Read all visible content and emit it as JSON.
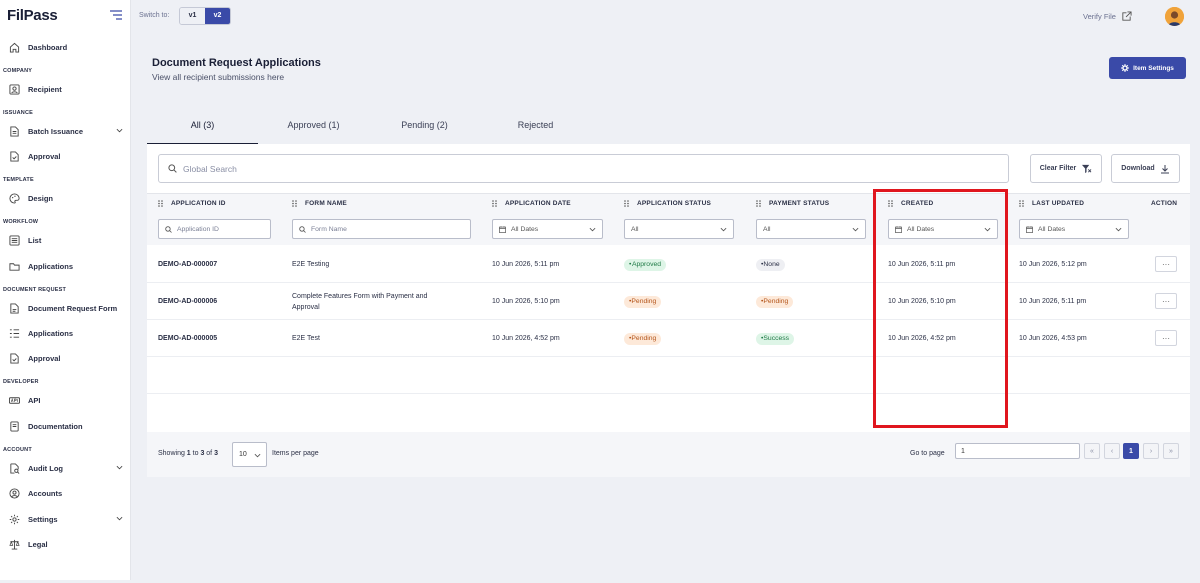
{
  "app": {
    "logo": "FilPass"
  },
  "sidebar": {
    "dashboard": "Dashboard",
    "sections": {
      "company": "COMPANY",
      "issuance": "ISSUANCE",
      "template": "TEMPLATE",
      "workflow": "WORKFLOW",
      "document_request": "DOCUMENT REQUEST",
      "developer": "DEVELOPER",
      "account": "ACCOUNT"
    },
    "items": {
      "recipient": "Recipient",
      "batch_issuance": "Batch Issuance",
      "approval": "Approval",
      "design": "Design",
      "list": "List",
      "applications": "Applications",
      "document_request_form": "Document Request Form",
      "dr_applications": "Applications",
      "dr_approval": "Approval",
      "api": "API",
      "documentation": "Documentation",
      "audit_log": "Audit Log",
      "accounts": "Accounts",
      "settings": "Settings",
      "legal": "Legal"
    }
  },
  "topbar": {
    "switch_label": "Switch to:",
    "v1": "v1",
    "v2": "v2",
    "verify_file": "Verify File"
  },
  "header": {
    "title": "Document Request Applications",
    "subtitle": "View all recipient submissions here",
    "item_settings": "Item Settings"
  },
  "tabs": [
    "All (3)",
    "Approved (1)",
    "Pending (2)",
    "Rejected"
  ],
  "toolbar": {
    "search_placeholder": "Global Search",
    "clear_filter": "Clear Filter",
    "download": "Download"
  },
  "columns": {
    "application_id": "APPLICATION ID",
    "form_name": "FORM NAME",
    "application_date": "APPLICATION DATE",
    "application_status": "APPLICATION STATUS",
    "payment_status": "PAYMENT STATUS",
    "created": "CREATED",
    "last_updated": "LAST UPDATED",
    "action": "ACTION"
  },
  "filters": {
    "application_id_placeholder": "Application ID",
    "form_name_placeholder": "Form Name",
    "all_dates": "All Dates",
    "all": "All"
  },
  "rows": [
    {
      "id": "DEMO-AD-000007",
      "form_name": "E2E Testing",
      "application_date": "10 Jun 2026, 5:11 pm",
      "application_status": "Approved",
      "payment_status": "None",
      "created": "10 Jun 2026, 5:11 pm",
      "last_updated": "10 Jun 2026, 5:12 pm"
    },
    {
      "id": "DEMO-AD-000006",
      "form_name_line1": "Complete Features Form with Payment and",
      "form_name_line2": "Approval",
      "application_date": "10 Jun 2026, 5:10 pm",
      "application_status": "Pending",
      "payment_status": "Pending",
      "created": "10 Jun 2026, 5:10 pm",
      "last_updated": "10 Jun 2026, 5:11 pm"
    },
    {
      "id": "DEMO-AD-000005",
      "form_name": "E2E Test",
      "application_date": "10 Jun 2026, 4:52 pm",
      "application_status": "Pending",
      "payment_status": "Success",
      "created": "10 Jun 2026, 4:52 pm",
      "last_updated": "10 Jun 2026, 4:53 pm"
    }
  ],
  "pagination": {
    "showing_prefix": "Showing ",
    "from": "1",
    "to_word": " to ",
    "to": "3",
    "of_word": " of ",
    "total": "3",
    "per_page": "10",
    "items_per_page": "Items per page",
    "go_to_page": "Go to page",
    "go_to_value": "1",
    "current_page": "1",
    "first": "«",
    "prev": "‹",
    "next": "›",
    "last": "»"
  },
  "row_action_glyph": "···",
  "colors": {
    "accent": "#3a4aa8",
    "highlight": "#e0161e",
    "approved": "#1f7a46",
    "pending": "#b5561c"
  }
}
